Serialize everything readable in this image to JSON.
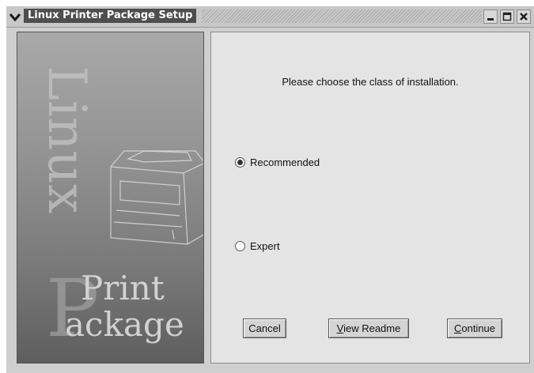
{
  "window": {
    "title": "Linux Printer Package Setup"
  },
  "sidebar": {
    "brand_word_1": "Linux",
    "brand_word_2": "Print",
    "brand_word_3": "ackage"
  },
  "content": {
    "prompt": "Please choose the class of installation.",
    "options": [
      {
        "label": "Recommended",
        "selected": true
      },
      {
        "label": "Expert",
        "selected": false
      }
    ]
  },
  "buttons": {
    "cancel": "Cancel",
    "readme_mnemonic": "V",
    "readme_rest": "iew Readme",
    "continue_mnemonic": "C",
    "continue_rest": "ontinue"
  }
}
